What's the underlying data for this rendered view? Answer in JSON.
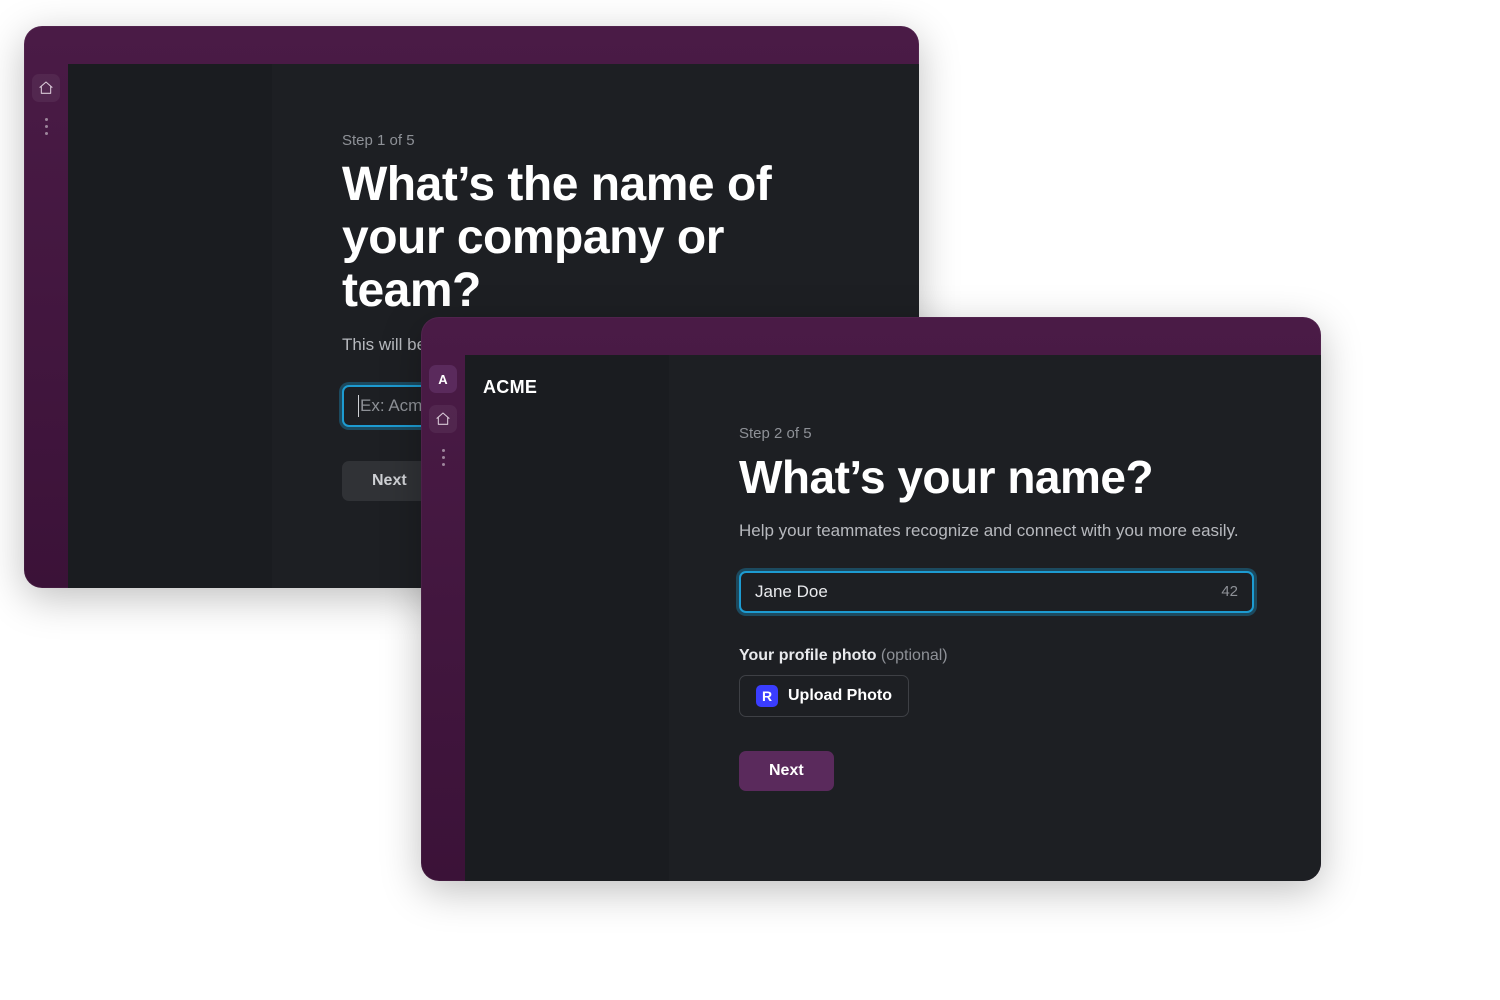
{
  "window1": {
    "step": "Step 1 of 5",
    "headline": "What’s the name of your company or team?",
    "subtext": "This will be the name of your Slack workspace.",
    "input_placeholder": "Ex: Acme",
    "next_label": "Next"
  },
  "window2": {
    "workspace_name": "ACME",
    "avatar_letter": "A",
    "step": "Step 2 of 5",
    "headline": "What’s your name?",
    "subtext": "Help your teammates recognize and connect with you more easily.",
    "input_value": "Jane Doe",
    "char_count": "42",
    "photo_label": "Your profile photo",
    "photo_optional": "(optional)",
    "upload_chip": "R",
    "upload_label": "Upload Photo",
    "next_label": "Next"
  }
}
